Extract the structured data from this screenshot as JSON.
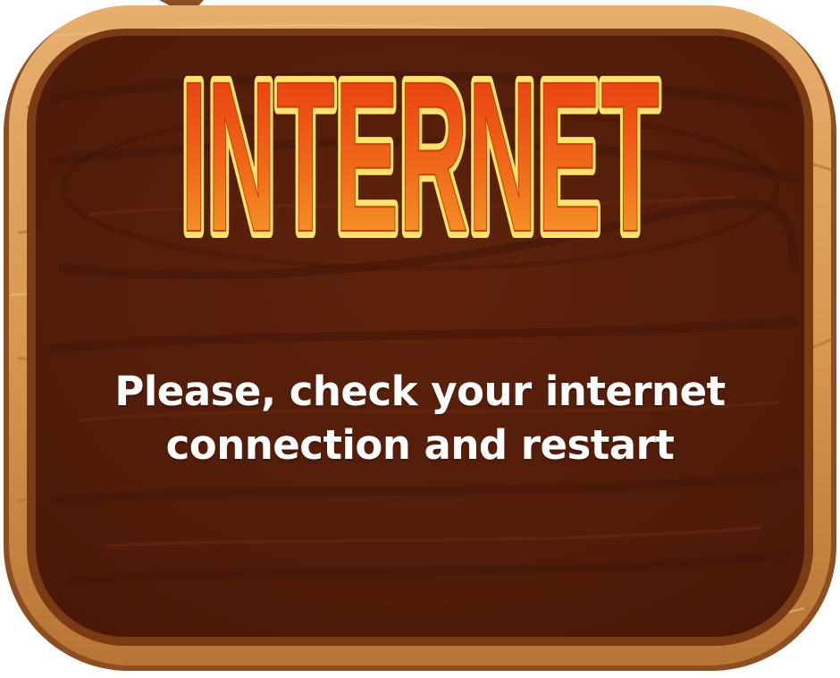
{
  "dialog": {
    "title": "INTERNET",
    "message": "Please, check your internet connection and restart"
  },
  "colors": {
    "frame_light": "#E2A262",
    "frame_mid": "#C9864A",
    "frame_dark": "#9A5A2A",
    "board": "#571F0B",
    "board_grain": "#45170A",
    "title_top": "#E8320E",
    "title_bottom": "#F7A72C",
    "title_outline": "#FFE36A",
    "message_text": "#FFFFFF"
  }
}
